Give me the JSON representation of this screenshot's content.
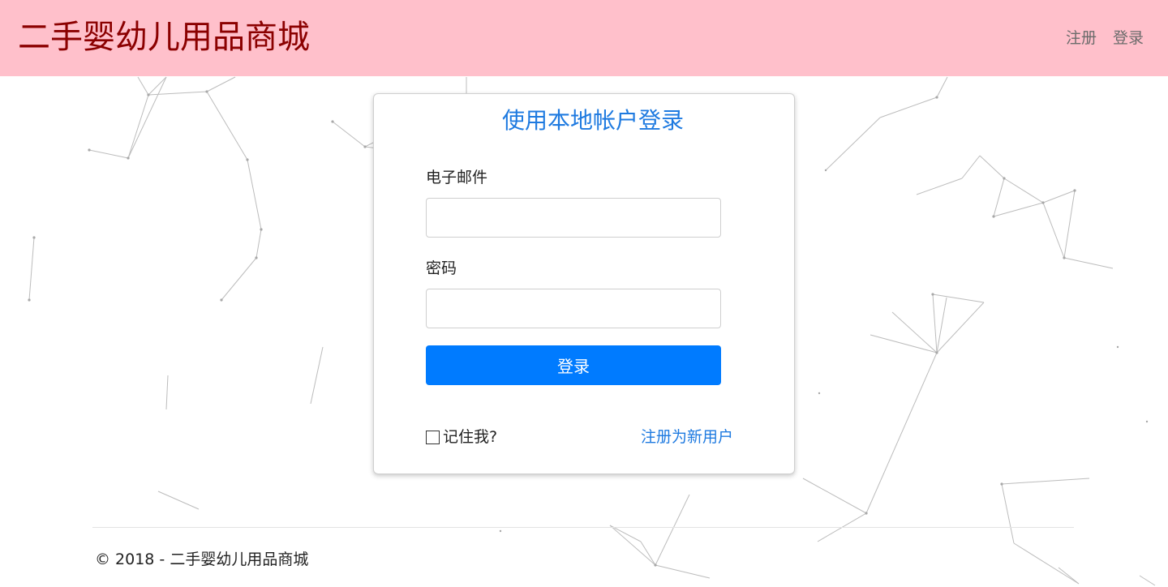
{
  "navbar": {
    "brand": "二手婴幼儿用品商城",
    "links": [
      "注册",
      "登录"
    ],
    "background_color": "#ffc0cb",
    "brand_color": "#8b0000"
  },
  "login": {
    "title": "使用本地帐户登录",
    "email_label": "电子邮件",
    "email_value": "",
    "password_label": "密码",
    "password_value": "",
    "submit_label": "登录",
    "remember_label": "记住我?",
    "register_link": "注册为新用户",
    "accent_color": "#007bff"
  },
  "footer": {
    "text": "© 2018 - 二手婴幼儿用品商城"
  }
}
